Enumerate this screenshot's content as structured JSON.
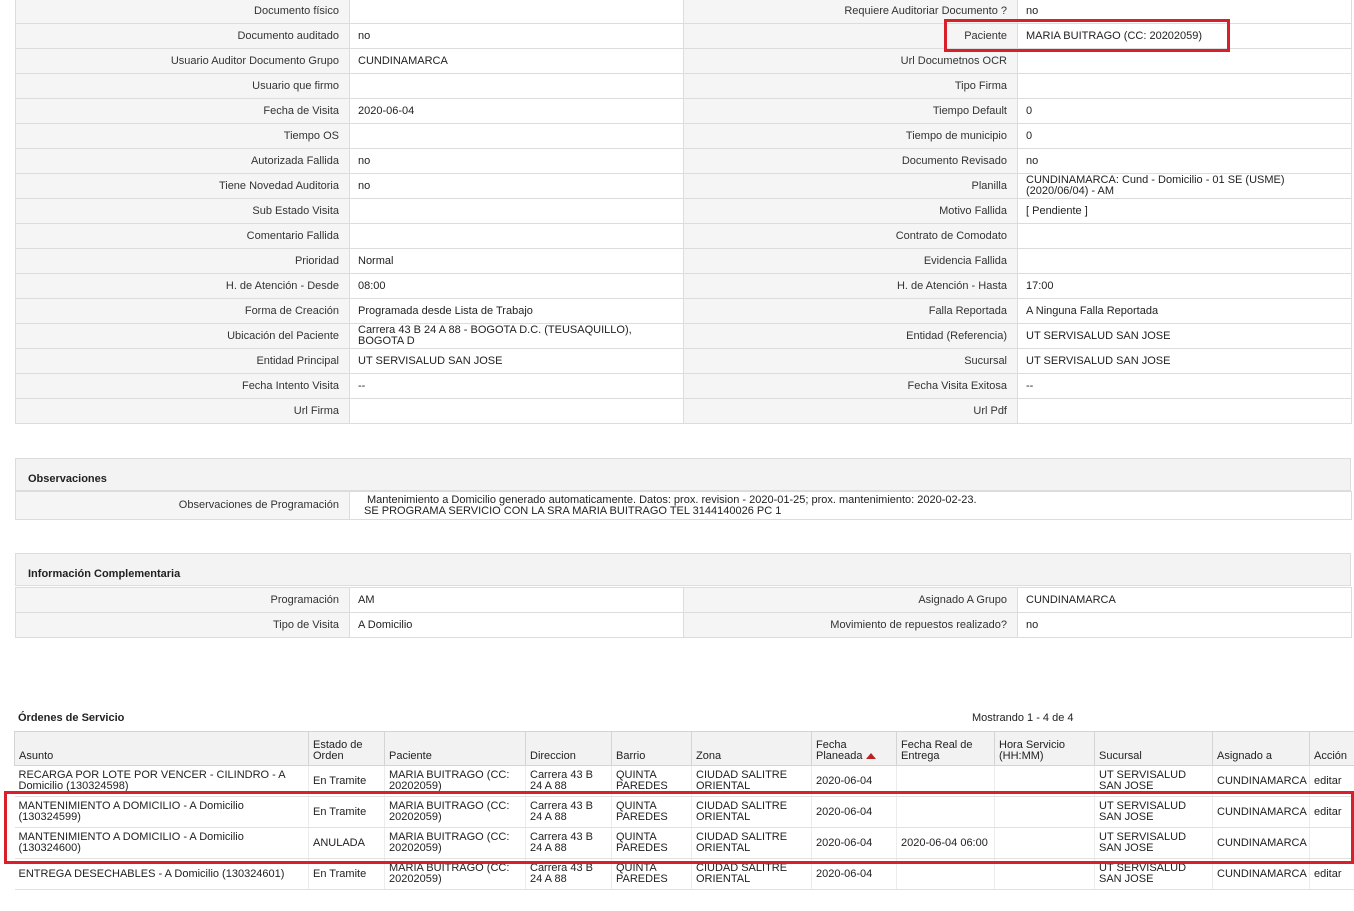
{
  "details": {
    "rows": [
      {
        "l1": "Documento físico",
        "v1": "",
        "l2": "Requiere Auditoriar Documento ?",
        "v2": "no"
      },
      {
        "l1": "Documento auditado",
        "v1": "no",
        "l2": "Paciente",
        "v2": "MARIA BUITRAGO (CC: 20202059)"
      },
      {
        "l1": "Usuario Auditor Documento Grupo",
        "v1": "CUNDINAMARCA",
        "l2": "Url Documetnos OCR",
        "v2": ""
      },
      {
        "l1": "Usuario que firmo",
        "v1": "",
        "l2": "Tipo Firma",
        "v2": ""
      },
      {
        "l1": "Fecha de Visita",
        "v1": "2020-06-04",
        "l2": "Tiempo Default",
        "v2": "0"
      },
      {
        "l1": "Tiempo OS",
        "v1": "",
        "l2": "Tiempo de municipio",
        "v2": "0"
      },
      {
        "l1": "Autorizada Fallida",
        "v1": "no",
        "l2": "Documento Revisado",
        "v2": "no"
      },
      {
        "l1": "Tiene Novedad Auditoria",
        "v1": "no",
        "l2": "Planilla",
        "v2": "CUNDINAMARCA: Cund - Domicilio - 01 SE (USME) (2020/06/04) - AM"
      },
      {
        "l1": "Sub Estado Visita",
        "v1": "",
        "l2": "Motivo Fallida",
        "v2": "[ Pendiente ]"
      },
      {
        "l1": "Comentario Fallida",
        "v1": "",
        "l2": "Contrato de Comodato",
        "v2": ""
      },
      {
        "l1": "Prioridad",
        "v1": "Normal",
        "l2": "Evidencia Fallida",
        "v2": ""
      },
      {
        "l1": "H. de Atención - Desde",
        "v1": "08:00",
        "l2": "H. de Atención - Hasta",
        "v2": "17:00"
      },
      {
        "l1": "Forma de Creación",
        "v1": "Programada desde Lista de Trabajo",
        "l2": "Falla Reportada",
        "v2": "A Ninguna Falla Reportada"
      },
      {
        "l1": "Ubicación del Paciente",
        "v1": "Carrera 43 B 24 A 88 - BOGOTA D.C. (TEUSAQUILLO), BOGOTA D",
        "l2": "Entidad (Referencia)",
        "v2": "UT SERVISALUD SAN JOSE"
      },
      {
        "l1": "Entidad Principal",
        "v1": "UT SERVISALUD SAN JOSE",
        "l2": "Sucursal",
        "v2": "UT SERVISALUD SAN JOSE"
      },
      {
        "l1": "Fecha Intento Visita",
        "v1": "--",
        "l2": "Fecha Visita Exitosa",
        "v2": "--"
      },
      {
        "l1": "Url Firma",
        "v1": "",
        "l2": "Url Pdf",
        "v2": ""
      }
    ]
  },
  "observaciones": {
    "title": "Observaciones",
    "label": "Observaciones de Programación",
    "line1": "Mantenimiento a Domicilio generado automaticamente. Datos: prox. revision - 2020-01-25; prox. mantenimiento: 2020-02-23.",
    "line2": "SE PROGRAMA SERVICIO CON LA SRA MARIA BUITRAGO TEL 3144140026 PC 1"
  },
  "complementaria": {
    "title": "Información Complementaria",
    "rows": [
      {
        "l1": "Programación",
        "v1": "AM",
        "l2": "Asignado A Grupo",
        "v2": "CUNDINAMARCA"
      },
      {
        "l1": "Tipo de Visita",
        "v1": "A Domicilio",
        "l2": "Movimiento de repuestos realizado?",
        "v2": "no"
      }
    ]
  },
  "orders": {
    "title": "Órdenes de Servicio",
    "count": "Mostrando 1 - 4 de 4",
    "headers": [
      "Asunto",
      "Estado de Orden",
      "Paciente",
      "Direccion",
      "Barrio",
      "Zona",
      "Fecha Planeada",
      "Fecha Real de Entrega",
      "Hora Servicio (HH:MM)",
      "Sucursal",
      "Asignado a",
      "Acción"
    ],
    "rows": [
      {
        "asunto": "RECARGA POR LOTE POR VENCER - CILINDRO - A Domicilio (130324598)",
        "estado": "En Tramite",
        "paciente": "MARIA BUITRAGO (CC: 20202059)",
        "direccion": "Carrera 43 B 24 A 88",
        "barrio": "QUINTA PAREDES",
        "zona": "CIUDAD SALITRE ORIENTAL",
        "fecha": "2020-06-04",
        "fecha_real": "",
        "hora": "",
        "sucursal": "UT SERVISALUD SAN JOSE",
        "asignado": "CUNDINAMARCA",
        "accion": "editar"
      },
      {
        "asunto": "MANTENIMIENTO A DOMICILIO - A Domicilio (130324599)",
        "estado": "En Tramite",
        "paciente": "MARIA BUITRAGO (CC: 20202059)",
        "direccion": "Carrera 43 B 24 A 88",
        "barrio": "QUINTA PAREDES",
        "zona": "CIUDAD SALITRE ORIENTAL",
        "fecha": "2020-06-04",
        "fecha_real": "",
        "hora": "",
        "sucursal": "UT SERVISALUD SAN JOSE",
        "asignado": "CUNDINAMARCA",
        "accion": "editar"
      },
      {
        "asunto": "MANTENIMIENTO A DOMICILIO - A Domicilio (130324600)",
        "estado": "ANULADA",
        "paciente": "MARIA BUITRAGO (CC: 20202059)",
        "direccion": "Carrera 43 B 24 A 88",
        "barrio": "QUINTA PAREDES",
        "zona": "CIUDAD SALITRE ORIENTAL",
        "fecha": "2020-06-04",
        "fecha_real": "2020-06-04 06:00",
        "hora": "",
        "sucursal": "UT SERVISALUD SAN JOSE",
        "asignado": "CUNDINAMARCA",
        "accion": ""
      },
      {
        "asunto": "ENTREGA DESECHABLES - A Domicilio (130324601)",
        "estado": "En Tramite",
        "paciente": "MARIA BUITRAGO (CC: 20202059)",
        "direccion": "Carrera 43 B 24 A 88",
        "barrio": "QUINTA PAREDES",
        "zona": "CIUDAD SALITRE ORIENTAL",
        "fecha": "2020-06-04",
        "fecha_real": "",
        "hora": "",
        "sucursal": "UT SERVISALUD SAN JOSE",
        "asignado": "CUNDINAMARCA",
        "accion": "editar"
      }
    ]
  },
  "colors": {
    "highlight": "#d9202a",
    "label_bg": "#f5f5f5",
    "sort_arrow": "#b22222"
  }
}
